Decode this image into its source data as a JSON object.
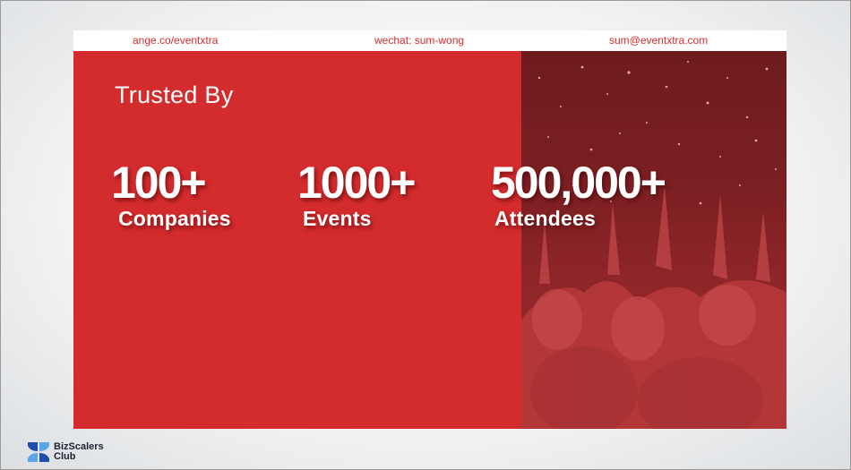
{
  "contact": {
    "website": "ange.co/eventxtra",
    "wechat": "wechat: sum-wong",
    "email": "sum@eventxtra.com"
  },
  "heading": "Trusted By",
  "stats": [
    {
      "value": "100+",
      "label": "Companies"
    },
    {
      "value": "1000+",
      "label": "Events"
    },
    {
      "value": "500,000+",
      "label": "Attendees"
    }
  ],
  "logo": {
    "line1": "BizScalers",
    "line2": "Club"
  },
  "colors": {
    "panel_red": "#d42b2d",
    "photo_dark_red": "#7b1f22",
    "contact_text": "#d92d2d",
    "logo_blue_dark": "#1f4fa8",
    "logo_blue_light": "#58a6e8"
  }
}
